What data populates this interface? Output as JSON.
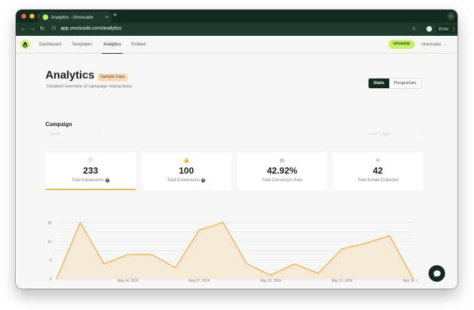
{
  "browser": {
    "tab_title": "Analytics - Onvocado",
    "tab_close": "×",
    "new_tab": "+",
    "tab_menu": "⌄",
    "url": "app.onvocado.com/analytics",
    "error_label": "Error",
    "error_menu": "⋮",
    "traffic_lights": [
      "#ff5f57",
      "#febc2e",
      "#28c840"
    ]
  },
  "nav": {
    "items": [
      "Dashboard",
      "Templates",
      "Analytics",
      "Embed"
    ],
    "active": "Analytics",
    "upgrade": "UPGRADE",
    "user": "onvocado",
    "user_chevron": "⌄"
  },
  "header": {
    "title": "Analytics",
    "badge": "Sample Data",
    "subtitle": "Detailed overview of campaign interactions",
    "toggle": [
      "Stats",
      "Responses"
    ]
  },
  "campaign": {
    "title": "Campaign",
    "selected": "Demo",
    "range": "Last 7 days"
  },
  "stats": [
    {
      "icon": "eye-icon",
      "glyph": "👁",
      "value": "233",
      "label": "Total Impressions",
      "help": "?"
    },
    {
      "icon": "thumbs-up-icon",
      "glyph": "👍",
      "value": "100",
      "label": "Total Conversions",
      "help": "?"
    },
    {
      "icon": "conversion-rate-icon",
      "glyph": "▤",
      "value": "42.92%",
      "label": "Total Conversion Rate",
      "help": ""
    },
    {
      "icon": "mail-icon",
      "glyph": "✉",
      "value": "42",
      "label": "Total Emails Collected",
      "help": ""
    }
  ],
  "colors": {
    "accent": "#e8b14a",
    "brand": "#c6f06a",
    "dark": "#132a1f"
  },
  "chart_data": {
    "type": "area",
    "x_ticks": [
      "May 04, 2024",
      "May 07, 2024",
      "May 10, 2024",
      "May 13, 2024",
      "May 16, 2024"
    ],
    "y_ticks": [
      0,
      5,
      10,
      15
    ],
    "ylim": [
      0,
      15
    ],
    "x_index_range": [
      0,
      15
    ],
    "series": [
      {
        "values": [
          0,
          15,
          4,
          6.5,
          6.5,
          3,
          13,
          15,
          4,
          1,
          4,
          1.5,
          8,
          9.5,
          11.5,
          0
        ]
      }
    ],
    "grid": true,
    "legend": "none"
  }
}
